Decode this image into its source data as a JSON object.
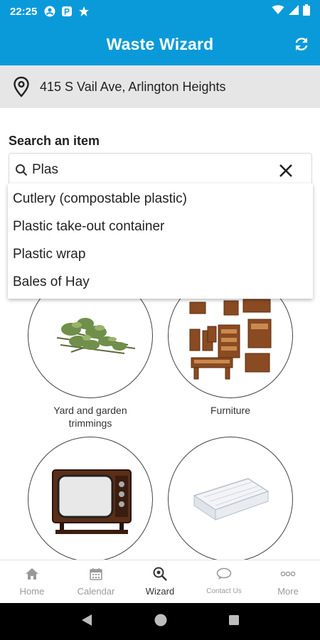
{
  "status": {
    "time": "22:25"
  },
  "app": {
    "title": "Waste Wizard"
  },
  "address": {
    "text": "415 S Vail Ave, Arlington Heights"
  },
  "search": {
    "label": "Search an item",
    "value": "Plas",
    "suggestions": [
      "Cutlery (compostable plastic)",
      "Plastic take-out container",
      "Plastic wrap",
      "Bales of Hay"
    ]
  },
  "categories": [
    {
      "label": "Yard and garden\ntrimmings",
      "icon": "yard-trimmings-image"
    },
    {
      "label": "Furniture",
      "icon": "furniture-image"
    },
    {
      "label": "",
      "icon": "television-image"
    },
    {
      "label": "",
      "icon": "mattress-image"
    }
  ],
  "tabs": [
    {
      "label": "Home",
      "icon": "home-icon"
    },
    {
      "label": "Calendar",
      "icon": "calendar-icon"
    },
    {
      "label": "Wizard",
      "icon": "wizard-icon",
      "active": true
    },
    {
      "label": "Contact Us",
      "icon": "chat-icon"
    },
    {
      "label": "More",
      "icon": "more-icon"
    }
  ],
  "colors": {
    "primary": "#0a9ad9",
    "address_bg": "#e6e6e6",
    "tab_inactive": "#9a9a9a"
  }
}
